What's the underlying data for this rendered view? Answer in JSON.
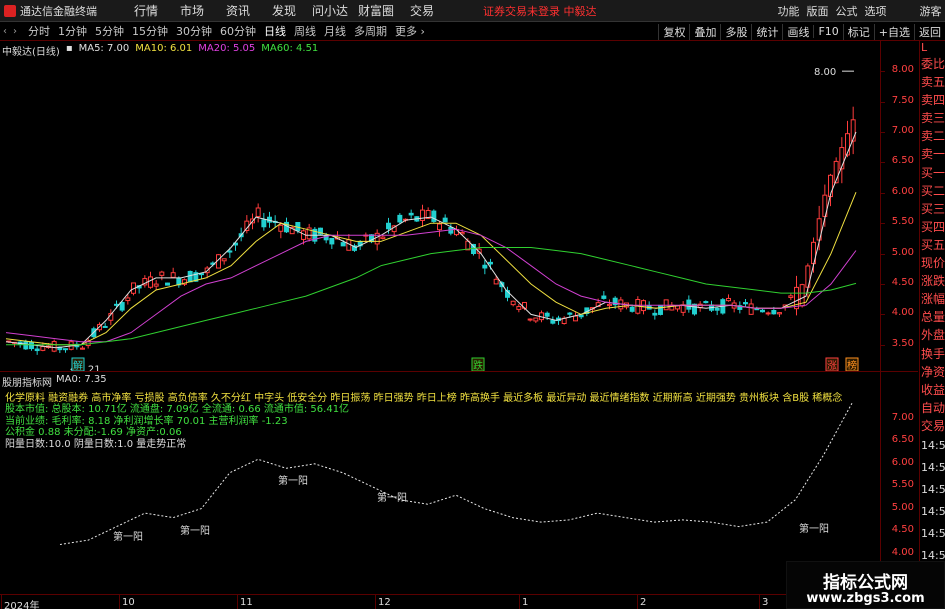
{
  "app": {
    "title": "通达信金融终端",
    "menu": [
      "行情",
      "市场",
      "资讯",
      "发现",
      "问小达",
      "财富圈",
      "交易"
    ],
    "notice": "证券交易未登录  中毅达",
    "right_menu": [
      "功能",
      "版面",
      "公式",
      "选项"
    ],
    "guest": "游客"
  },
  "periodbar": {
    "periods": [
      "分时",
      "1分钟",
      "5分钟",
      "15分钟",
      "30分钟",
      "60分钟",
      "日线",
      "周线",
      "月线",
      "多周期",
      "更多 ›"
    ],
    "active": "日线",
    "tools": [
      "复权",
      "叠加",
      "多股",
      "统计",
      "画线",
      "F10",
      "标记",
      "+自选",
      "返回"
    ]
  },
  "right_panel": {
    "l_label": "L",
    "red_items": [
      "委比",
      "卖五",
      "卖四",
      "卖三",
      "卖二",
      "卖一"
    ],
    "green_items": [
      "买一",
      "买二",
      "买三",
      "买四",
      "买五"
    ],
    "info_items": [
      "现价",
      "涨跌",
      "涨幅",
      "总量",
      "外盘",
      "换手",
      "净资",
      "收益"
    ],
    "bottom_items": [
      "自动",
      "交易"
    ],
    "times": [
      "14:5",
      "14:5",
      "14:5",
      "14:5",
      "14:5",
      "14:5",
      "14:5",
      "14:5"
    ]
  },
  "main_chart": {
    "stock_label": "中毅达(日线)",
    "ma5": "MA5: 7.00",
    "ma10": "MA10: 6.01",
    "ma20": "MA20: 5.05",
    "ma60": "MA60: 4.51",
    "high_label": "8.00",
    "low_label": "3.21",
    "markers": [
      "解",
      "跌",
      "涨",
      "榜"
    ],
    "colors": {
      "up": "#ff3c3c",
      "down": "#22d0d0",
      "ma5": "#e0e0e0",
      "ma10": "#f0e040",
      "ma20": "#d040d0",
      "ma60": "#30d030"
    }
  },
  "indicator": {
    "name": "股朋指标网",
    "value": "MA0: 7.35",
    "lines": [
      {
        "text": "化学原料 融资融券 高市净率 亏损股 高负债率 久不分红 中字头 低安全分 昨日振荡 昨日强势 昨日上榜 昨高换手 最近多板 最近异动 最近情绪指数 近期新高 近期强势 贵州板块 含B股 稀概念",
        "color": "y"
      },
      {
        "text": "股本市值: 总股本: 10.71亿 流通盘: 7.09亿 全流通: 0.66 流通市值: 56.41亿",
        "color": "g"
      },
      {
        "text": "当前业绩: 毛利率: 8.18 净利润增长率 70.01 主营利润率 -1.23",
        "color": "g"
      },
      {
        "text": "公积金 0.88 未分配:-1.69 净资产:0.06",
        "color": "g"
      },
      {
        "text": "阳量日数:10.0 阴量日数:1.0         量走势正常",
        "color": "w"
      }
    ],
    "labels": [
      "第一阳",
      "第一阳",
      "第一阳",
      "第一阳",
      "第一阳"
    ]
  },
  "chart_data": [
    {
      "type": "line",
      "title": "中毅达(日线)",
      "series": [
        {
          "name": "MA5",
          "values": [
            3.55,
            3.5,
            3.45,
            3.5,
            3.9,
            4.4,
            4.6,
            4.6,
            4.7,
            5.1,
            5.6,
            5.5,
            5.3,
            5.3,
            5.1,
            5.3,
            5.55,
            5.6,
            5.4,
            5.0,
            4.4,
            4.0,
            3.9,
            4.0,
            4.2,
            4.15,
            4.1,
            4.15,
            4.1,
            4.15,
            4.1,
            4.1,
            4.3,
            6.0,
            7.0
          ]
        },
        {
          "name": "MA10",
          "values": [
            3.6,
            3.55,
            3.5,
            3.5,
            3.7,
            4.1,
            4.4,
            4.5,
            4.6,
            4.8,
            5.2,
            5.5,
            5.4,
            5.3,
            5.2,
            5.2,
            5.35,
            5.5,
            5.5,
            5.3,
            4.9,
            4.5,
            4.2,
            4.0,
            4.1,
            4.15,
            4.1,
            4.15,
            4.15,
            4.15,
            4.1,
            4.1,
            4.2,
            5.0,
            6.01
          ]
        },
        {
          "name": "MA20",
          "values": [
            3.7,
            3.65,
            3.6,
            3.55,
            3.55,
            3.7,
            4.0,
            4.3,
            4.5,
            4.6,
            4.8,
            5.0,
            5.2,
            5.3,
            5.3,
            5.3,
            5.3,
            5.35,
            5.4,
            5.3,
            5.1,
            4.8,
            4.5,
            4.3,
            4.2,
            4.15,
            4.15,
            4.15,
            4.15,
            4.15,
            4.1,
            4.1,
            4.15,
            4.5,
            5.05
          ]
        },
        {
          "name": "MA60",
          "values": [
            3.5,
            3.5,
            3.5,
            3.5,
            3.55,
            3.6,
            3.7,
            3.8,
            3.9,
            4.0,
            4.1,
            4.2,
            4.3,
            4.45,
            4.6,
            4.8,
            4.9,
            5.0,
            5.05,
            5.1,
            5.1,
            5.1,
            5.05,
            5.0,
            4.9,
            4.8,
            4.7,
            4.6,
            4.5,
            4.45,
            4.4,
            4.35,
            4.35,
            4.4,
            4.51
          ]
        }
      ],
      "ylim": [
        3.2,
        8.2
      ],
      "yticks": [
        "8.00",
        "7.50",
        "7.00",
        "6.50",
        "6.00",
        "5.50",
        "5.00",
        "4.50",
        "4.00",
        "3.50"
      ]
    },
    {
      "type": "line",
      "title": "股朋指标网",
      "series": [
        {
          "name": "MA0",
          "values": [
            4.2,
            4.3,
            4.6,
            4.9,
            4.8,
            5.0,
            5.8,
            6.1,
            5.9,
            6.0,
            5.8,
            5.5,
            5.2,
            5.1,
            5.3,
            5.0,
            4.8,
            4.7,
            4.75,
            4.9,
            4.8,
            4.7,
            4.75,
            4.7,
            4.6,
            4.7,
            5.2,
            6.2,
            7.35
          ]
        }
      ],
      "ylim": [
        3.9,
        7.6
      ],
      "yticks": [
        "7.00",
        "6.50",
        "6.00",
        "5.50",
        "5.00",
        "4.50",
        "4.00"
      ]
    }
  ],
  "date_axis": [
    "2024年",
    "10",
    "11",
    "12",
    "1",
    "2",
    "3"
  ],
  "watermark": {
    "line1": "指标公式网",
    "line2": "www.zbgs3.com"
  }
}
